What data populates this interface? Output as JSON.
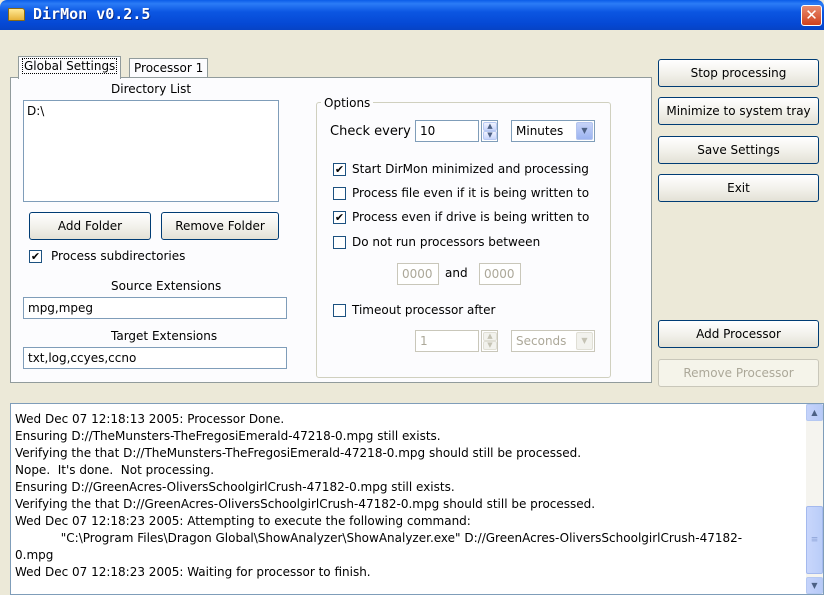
{
  "window": {
    "title": "DirMon v0.2.5",
    "close_glyph": "✕"
  },
  "tabs": [
    {
      "label": "Global Settings"
    },
    {
      "label": "Processor 1"
    }
  ],
  "directory": {
    "label": "Directory List",
    "items": [
      "D:\\"
    ],
    "add_label": "Add Folder",
    "remove_label": "Remove Folder",
    "subdirs_label": "Process subdirectories",
    "subdirs_checked": true
  },
  "source_ext": {
    "label": "Source Extensions",
    "value": "mpg,mpeg"
  },
  "target_ext": {
    "label": "Target Extensions",
    "value": "txt,log,ccyes,ccno"
  },
  "options": {
    "legend": "Options",
    "check_every_label": "Check every",
    "check_every_value": "10",
    "check_unit": "Minutes",
    "start_minimized_label": "Start DirMon minimized and processing",
    "start_minimized_checked": true,
    "process_written_label": "Process file even if it is being written to",
    "process_written_checked": false,
    "process_drive_label": "Process even if drive is being written to",
    "process_drive_checked": true,
    "no_run_between_label": "Do not run processors between",
    "no_run_between_checked": false,
    "time_from": "0000",
    "and_label": "and",
    "time_to": "0000",
    "timeout_label": "Timeout processor after",
    "timeout_checked": false,
    "timeout_value": "1",
    "timeout_unit": "Seconds"
  },
  "side_buttons": {
    "stop": "Stop processing",
    "minimize": "Minimize to system tray",
    "save": "Save Settings",
    "exit": "Exit",
    "add_processor": "Add Processor",
    "remove_processor": "Remove Processor"
  },
  "log": {
    "lines": [
      "Wed Dec 07 12:18:13 2005: Processor Done.",
      "Ensuring D://TheMunsters-TheFregosiEmerald-47218-0.mpg still exists.",
      "Verifying the that D://TheMunsters-TheFregosiEmerald-47218-0.mpg should still be processed.",
      "Nope.  It's done.  Not processing.",
      "Ensuring D://GreenAcres-OliversSchoolgirlCrush-47182-0.mpg still exists.",
      "Verifying the that D://GreenAcres-OliversSchoolgirlCrush-47182-0.mpg should still be processed.",
      "Wed Dec 07 12:18:23 2005: Attempting to execute the following command:",
      "            \"C:\\Program Files\\Dragon Global\\ShowAnalyzer\\ShowAnalyzer.exe\" D://GreenAcres-OliversSchoolgirlCrush-47182-",
      "0.mpg",
      "Wed Dec 07 12:18:23 2005: Waiting for processor to finish."
    ]
  },
  "glyphs": {
    "check": "✔",
    "up": "▲",
    "down": "▼",
    "grip": "≡"
  },
  "colors": {
    "titlebar": "#0548d4",
    "face": "#ece9d8",
    "panel": "#fcfcfe",
    "border": "#7f9db9"
  }
}
